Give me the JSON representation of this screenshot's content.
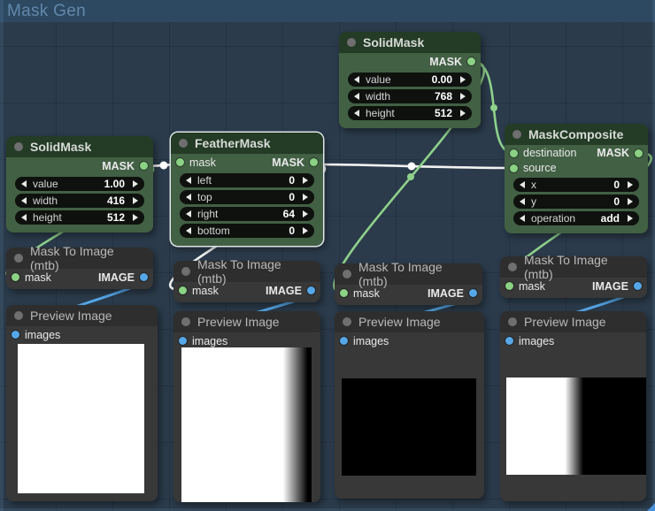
{
  "group_title": "Mask Gen",
  "nodes": {
    "solidmask_top": {
      "title": "SolidMask",
      "output": "MASK",
      "widgets": [
        {
          "label": "value",
          "value": "0.00"
        },
        {
          "label": "width",
          "value": "768"
        },
        {
          "label": "height",
          "value": "512"
        }
      ]
    },
    "solidmask_left": {
      "title": "SolidMask",
      "output": "MASK",
      "widgets": [
        {
          "label": "value",
          "value": "1.00"
        },
        {
          "label": "width",
          "value": "416"
        },
        {
          "label": "height",
          "value": "512"
        }
      ]
    },
    "feather_mask": {
      "title": "FeatherMask",
      "input": "mask",
      "output": "MASK",
      "widgets": [
        {
          "label": "left",
          "value": "0"
        },
        {
          "label": "top",
          "value": "0"
        },
        {
          "label": "right",
          "value": "64"
        },
        {
          "label": "bottom",
          "value": "0"
        }
      ]
    },
    "mask_composite": {
      "title": "MaskComposite",
      "inputs": [
        "destination",
        "source"
      ],
      "output": "MASK",
      "widgets": [
        {
          "label": "x",
          "value": "0"
        },
        {
          "label": "y",
          "value": "0"
        },
        {
          "label": "operation",
          "value": "add"
        }
      ]
    },
    "mask_to_image": {
      "title": "Mask To Image (mtb)",
      "input": "mask",
      "output": "IMAGE"
    },
    "preview_image": {
      "title": "Preview Image",
      "input": "images"
    }
  },
  "colors": {
    "canvas": "#2b3b4b",
    "mask_wire": "#8fd18b",
    "image_wire": "#55a7e8",
    "selected_wire": "#ffffff",
    "green_node_body": "#426044",
    "green_node_header": "#243b26",
    "dark_node_body": "#383838",
    "mask_port": "#8bd284",
    "image_port": "#55a7e8"
  }
}
